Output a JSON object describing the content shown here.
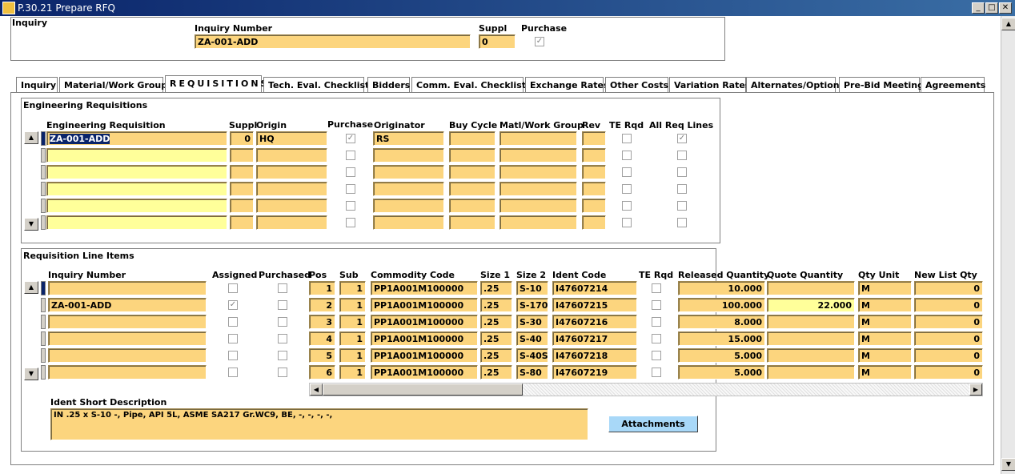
{
  "window": {
    "title": "P.30.21 Prepare RFQ"
  },
  "inquiry": {
    "section_label": "Inquiry",
    "number_label": "Inquiry Number",
    "number_value": "ZA-001-ADD",
    "suppl_label": "Suppl",
    "suppl_value": "0",
    "purchase_label": "Purchase"
  },
  "tabs": [
    "Inquiry",
    "Material/Work Groups",
    "REQUISITIONS",
    "Tech. Eval. Checklists",
    "Bidders",
    "Comm. Eval. Checklists",
    "Exchange Rates",
    "Other Costs",
    "Variation Rates",
    "Alternates/Options",
    "Pre-Bid Meeting",
    "Agreements"
  ],
  "eng_req": {
    "section_label": "Engineering Requisitions",
    "headers": {
      "req": "Engineering Requisition",
      "suppl": "Suppl",
      "origin": "Origin",
      "purchase": "Purchase",
      "originator": "Originator",
      "buy_cycle": "Buy Cycle",
      "matl_group": "Matl/Work Group",
      "rev": "Rev",
      "te_rqd": "TE Rqd",
      "all_lines": "All Req Lines"
    },
    "rows": [
      {
        "req": "ZA-001-ADD",
        "suppl": "0",
        "origin": "HQ",
        "originator": "RS",
        "buy_cycle": "",
        "matl_group": "",
        "rev": "",
        "purchase": true,
        "te_rqd": false,
        "all_lines": true
      }
    ]
  },
  "line_items": {
    "section_label": "Requisition Line Items",
    "headers": {
      "inquiry": "Inquiry Number",
      "assigned": "Assigned",
      "purchased": "Purchased",
      "pos": "Pos",
      "sub": "Sub",
      "commodity": "Commodity Code",
      "size1": "Size 1",
      "size2": "Size 2",
      "ident": "Ident Code",
      "te_rqd": "TE Rqd",
      "released": "Released Quantity",
      "quote": "Quote Quantity",
      "unit": "Qty Unit",
      "new_list": "New List Qty"
    },
    "rows": [
      {
        "inquiry": "",
        "assigned": false,
        "pos": "1",
        "sub": "1",
        "commodity": "PP1A001M100000",
        "size1": ".25",
        "size2": "S-10",
        "ident": "I47607214",
        "released": "10.000",
        "quote": "",
        "unit": "M",
        "new_list": "0"
      },
      {
        "inquiry": "ZA-001-ADD",
        "assigned": true,
        "pos": "2",
        "sub": "1",
        "commodity": "PP1A001M100000",
        "size1": ".25",
        "size2": "S-170",
        "ident": "I47607215",
        "released": "100.000",
        "quote": "22.000",
        "unit": "M",
        "new_list": "0"
      },
      {
        "inquiry": "",
        "assigned": false,
        "pos": "3",
        "sub": "1",
        "commodity": "PP1A001M100000",
        "size1": ".25",
        "size2": "S-30",
        "ident": "I47607216",
        "released": "8.000",
        "quote": "",
        "unit": "M",
        "new_list": "0"
      },
      {
        "inquiry": "",
        "assigned": false,
        "pos": "4",
        "sub": "1",
        "commodity": "PP1A001M100000",
        "size1": ".25",
        "size2": "S-40",
        "ident": "I47607217",
        "released": "15.000",
        "quote": "",
        "unit": "M",
        "new_list": "0"
      },
      {
        "inquiry": "",
        "assigned": false,
        "pos": "5",
        "sub": "1",
        "commodity": "PP1A001M100000",
        "size1": ".25",
        "size2": "S-40S",
        "ident": "I47607218",
        "released": "5.000",
        "quote": "",
        "unit": "M",
        "new_list": "0"
      },
      {
        "inquiry": "",
        "assigned": false,
        "pos": "6",
        "sub": "1",
        "commodity": "PP1A001M100000",
        "size1": ".25",
        "size2": "S-80",
        "ident": "I47607219",
        "released": "5.000",
        "quote": "",
        "unit": "M",
        "new_list": "0"
      }
    ]
  },
  "ident": {
    "label": "Ident Short Description",
    "value": "IN .25 x S-10 -,  Pipe, API 5L, ASME SA217 Gr.WC9, BE, -, -, -, -,"
  },
  "buttons": {
    "attachments": "Attachments"
  }
}
